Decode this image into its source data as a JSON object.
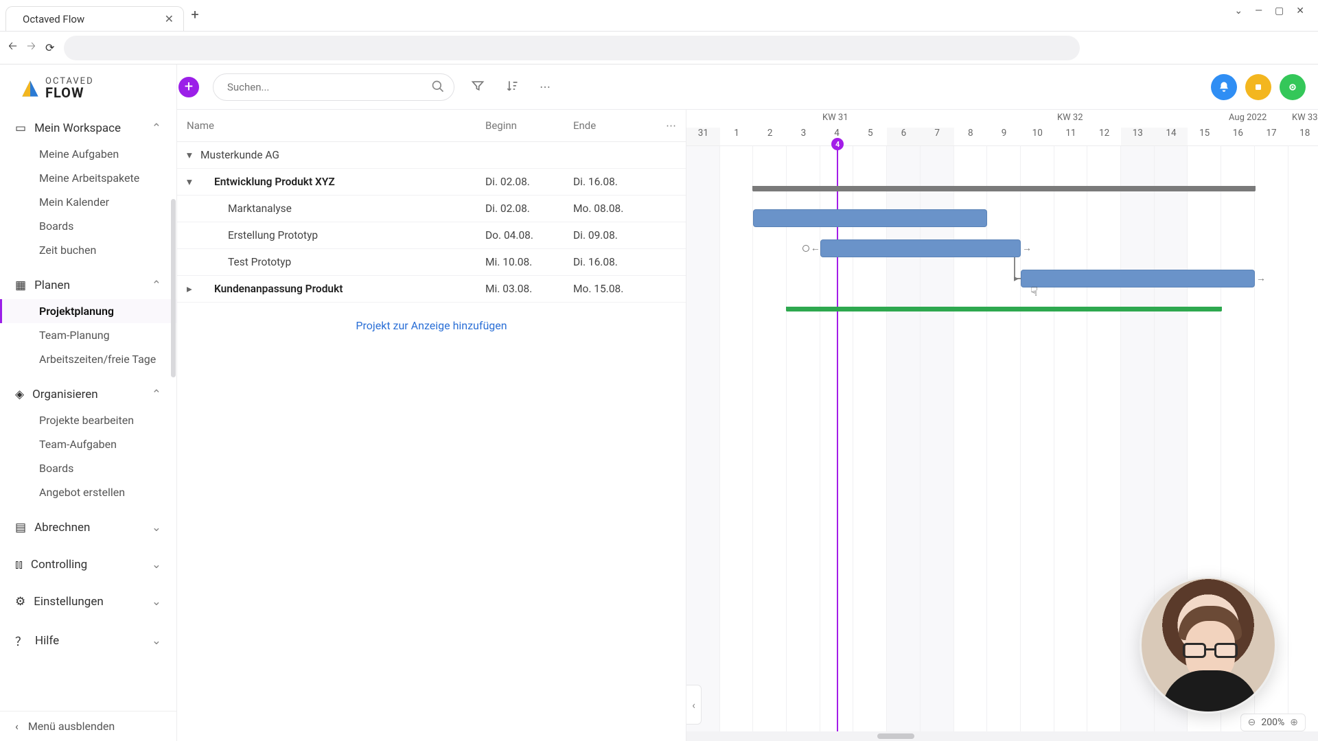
{
  "browser": {
    "tab_title": "Octaved Flow"
  },
  "logo": {
    "top": "OCTAVED",
    "bottom": "FLOW"
  },
  "sidebar": {
    "workspace": {
      "label": "Mein Workspace",
      "items": [
        "Meine Aufgaben",
        "Meine Arbeitspakete",
        "Mein Kalender",
        "Boards",
        "Zeit buchen"
      ]
    },
    "planen": {
      "label": "Planen",
      "items": [
        "Projektplanung",
        "Team-Planung",
        "Arbeitszeiten/freie Tage"
      ],
      "active_index": 0
    },
    "organisieren": {
      "label": "Organisieren",
      "items": [
        "Projekte bearbeiten",
        "Team-Aufgaben",
        "Boards",
        "Angebot erstellen"
      ]
    },
    "abrechnen": {
      "label": "Abrechnen"
    },
    "controlling": {
      "label": "Controlling"
    },
    "einstellungen": {
      "label": "Einstellungen"
    },
    "hilfe": {
      "label": "Hilfe"
    },
    "collapse": "Menü ausblenden"
  },
  "toolbar": {
    "search_placeholder": "Suchen..."
  },
  "columns": {
    "name": "Name",
    "begin": "Beginn",
    "end": "Ende"
  },
  "tasks": [
    {
      "name": "Musterkunde AG",
      "begin": "",
      "end": "",
      "level": 0,
      "expandable": true,
      "open": true,
      "bold": false
    },
    {
      "name": "Entwicklung Produkt XYZ",
      "begin": "Di. 02.08.",
      "end": "Di. 16.08.",
      "level": 1,
      "expandable": true,
      "open": true,
      "bold": true
    },
    {
      "name": "Marktanalyse",
      "begin": "Di. 02.08.",
      "end": "Mo. 08.08.",
      "level": 2,
      "expandable": false,
      "bold": false
    },
    {
      "name": "Erstellung Prototyp",
      "begin": "Do. 04.08.",
      "end": "Di. 09.08.",
      "level": 2,
      "expandable": false,
      "bold": false
    },
    {
      "name": "Test Prototyp",
      "begin": "Mi. 10.08.",
      "end": "Di. 16.08.",
      "level": 2,
      "expandable": false,
      "bold": false
    },
    {
      "name": "Kundenanpassung Produkt",
      "begin": "Mi. 03.08.",
      "end": "Mo. 15.08.",
      "level": 1,
      "expandable": true,
      "open": false,
      "bold": true
    }
  ],
  "add_project": "Projekt zur Anzeige hinzufügen",
  "timeline": {
    "weeks": [
      {
        "label": "KW 31",
        "pos": 198
      },
      {
        "label": "KW 32",
        "pos": 540
      },
      {
        "label": "Aug 2022",
        "pos": 790
      },
      {
        "label": "KW 33",
        "pos": 882
      }
    ],
    "days": [
      "31",
      "1",
      "2",
      "3",
      "4",
      "5",
      "6",
      "7",
      "8",
      "9",
      "10",
      "11",
      "12",
      "13",
      "14",
      "15",
      "16",
      "17",
      "18"
    ],
    "weekend_idx": [
      0,
      6,
      7,
      13,
      14
    ],
    "today_index": 4,
    "today_label": "4"
  },
  "zoom": {
    "value": "200%"
  },
  "chart_data": {
    "type": "gantt",
    "date_range": [
      "2022-07-31",
      "2022-08-18"
    ],
    "today": "2022-08-04",
    "rows": [
      {
        "name": "Entwicklung Produkt XYZ",
        "start": "2022-08-02",
        "end": "2022-08-16",
        "kind": "summary",
        "color": "#7a7a7a"
      },
      {
        "name": "Marktanalyse",
        "start": "2022-08-02",
        "end": "2022-08-08",
        "kind": "task",
        "color": "#6a93c9"
      },
      {
        "name": "Erstellung Prototyp",
        "start": "2022-08-04",
        "end": "2022-08-09",
        "kind": "task",
        "color": "#6a93c9",
        "depends_on": "Marktanalyse"
      },
      {
        "name": "Test Prototyp",
        "start": "2022-08-10",
        "end": "2022-08-16",
        "kind": "task",
        "color": "#6a93c9",
        "depends_on": "Erstellung Prototyp"
      },
      {
        "name": "Kundenanpassung Produkt",
        "start": "2022-08-03",
        "end": "2022-08-15",
        "kind": "summary",
        "color": "#2ea84f"
      }
    ]
  }
}
